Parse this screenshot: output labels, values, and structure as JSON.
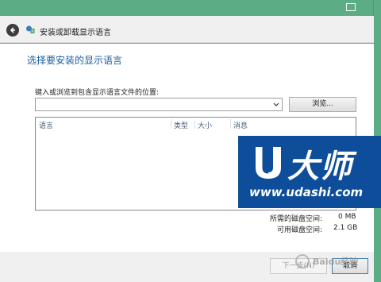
{
  "window": {
    "title": "安装或卸载显示语言"
  },
  "page": {
    "heading": "选择要安装的显示语言",
    "field_label": "键入或浏览到包含显示语言文件的位置:",
    "path_value": "",
    "browse_label": "浏览..."
  },
  "table": {
    "columns": [
      "语言",
      "类型",
      "大小",
      "消息"
    ],
    "rows": []
  },
  "summary": {
    "required_label": "所需的磁盘空间:",
    "required_value": "0 MB",
    "available_label": "可用磁盘空间:",
    "available_value": "2.1 GB"
  },
  "footer": {
    "next_label": "下一步(N)",
    "cancel_label": "取消"
  },
  "overlay": {
    "logo_text": "大师",
    "logo_url": "www.udashi.com",
    "watermark_text": "Baidu经验"
  },
  "colors": {
    "title_bar": "#5cad86",
    "heading": "#1a5d9e",
    "logo_bg": "#0e4d9a"
  }
}
